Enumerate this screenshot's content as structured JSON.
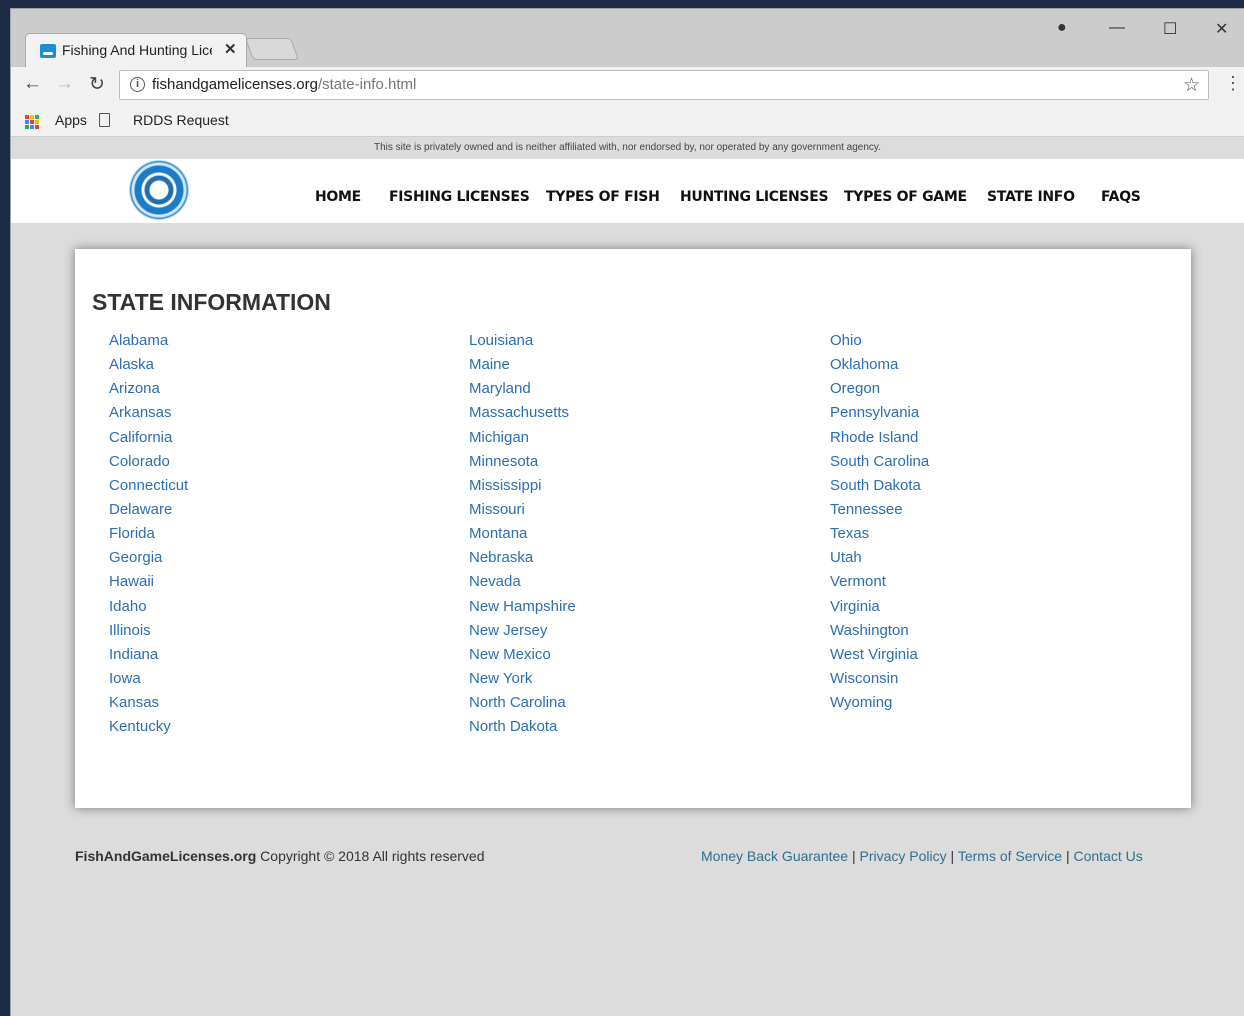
{
  "browser": {
    "tab_title": "Fishing And Hunting Lice",
    "url_domain": "fishandgamelicenses.org",
    "url_path": "/state-info.html",
    "bookmarks": [
      "Apps",
      "RDDS Request"
    ]
  },
  "site": {
    "disclaimer": "This site is privately owned and is neither affiliated with, nor endorsed by, nor operated by any government agency.",
    "nav": [
      "HOME",
      "FISHING LICENSES",
      "TYPES OF FISH",
      "HUNTING LICENSES",
      "TYPES OF GAME",
      "STATE INFO",
      "FAQS"
    ]
  },
  "main": {
    "heading": "STATE INFORMATION",
    "columns": [
      [
        "Alabama",
        "Alaska",
        "Arizona",
        "Arkansas",
        "California",
        "Colorado",
        "Connecticut",
        "Delaware",
        "Florida",
        "Georgia",
        "Hawaii",
        "Idaho",
        "Illinois",
        "Indiana",
        "Iowa",
        "Kansas",
        "Kentucky"
      ],
      [
        "Louisiana",
        "Maine",
        "Maryland",
        "Massachusetts",
        "Michigan",
        "Minnesota",
        "Mississippi",
        "Missouri",
        "Montana",
        "Nebraska",
        "Nevada",
        "New Hampshire",
        "New Jersey",
        "New Mexico",
        "New York",
        "North Carolina",
        "North Dakota"
      ],
      [
        "Ohio",
        "Oklahoma",
        "Oregon",
        "Pennsylvania",
        "Rhode Island",
        "South Carolina",
        "South Dakota",
        "Tennessee",
        "Texas",
        "Utah",
        "Vermont",
        "Virginia",
        "Washington",
        "West Virginia",
        "Wisconsin",
        "Wyoming"
      ]
    ]
  },
  "footer": {
    "site_name": "FishAndGameLicenses.org",
    "copyright": "Copyright © 2018 All rights reserved",
    "links": [
      "Money Back Guarantee",
      "Privacy Policy",
      "Terms of Service",
      "Contact Us"
    ],
    "separator": "|"
  }
}
